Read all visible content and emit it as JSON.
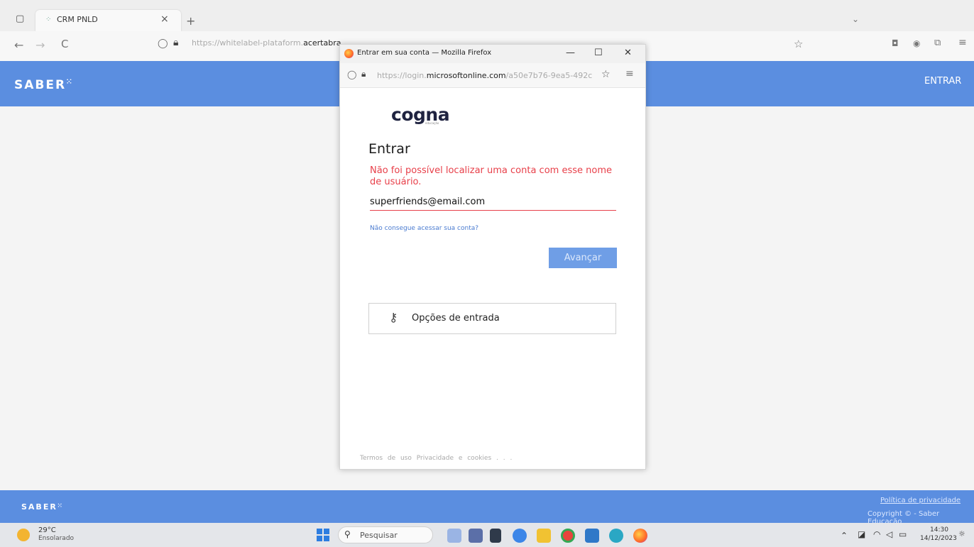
{
  "browser": {
    "tab_title": "CRM PNLD",
    "tab_close": "×",
    "new_tab": "+",
    "tabs_menu": "⌄",
    "back": "←",
    "forward": "→",
    "reload": "C",
    "url_prefix": "https://whitelabel-plataform.",
    "url_host": "acertabra"
  },
  "site": {
    "logo": "SABER",
    "header_login": "ENTRAR",
    "footer_logo": "SABER",
    "footer_privacy": "Política de privacidade",
    "footer_copyright": "Copyright © - Saber Educação"
  },
  "popup": {
    "window_title": "Entrar em sua conta — Mozilla Firefox",
    "minimize": "—",
    "maximize": "☐",
    "close": "✕",
    "url_prefix": "https://login.",
    "url_host": "microsoftonline.com",
    "url_suffix": "/a50e7b76-9ea5-492c",
    "brand_name": "cogna",
    "brand_sub": "educação",
    "heading": "Entrar",
    "error_message": "Não foi possível localizar uma conta com esse nome de usuário.",
    "email_value": "superfriends@email.com",
    "cant_access_link": "Não consegue acessar sua conta?",
    "next_button": "Avançar",
    "signin_options": "Opções de entrada",
    "footer": "Termos de uso   Privacidade e cookies   . . ."
  },
  "taskbar": {
    "temperature": "29°C",
    "weather": "Ensolarado",
    "search_label": "Pesquisar",
    "time": "14:30",
    "date": "14/12/2023"
  },
  "colors": {
    "brand_blue": "#5b8ee0",
    "error_red": "#e8404a",
    "button_blue": "#6f9ee6"
  }
}
